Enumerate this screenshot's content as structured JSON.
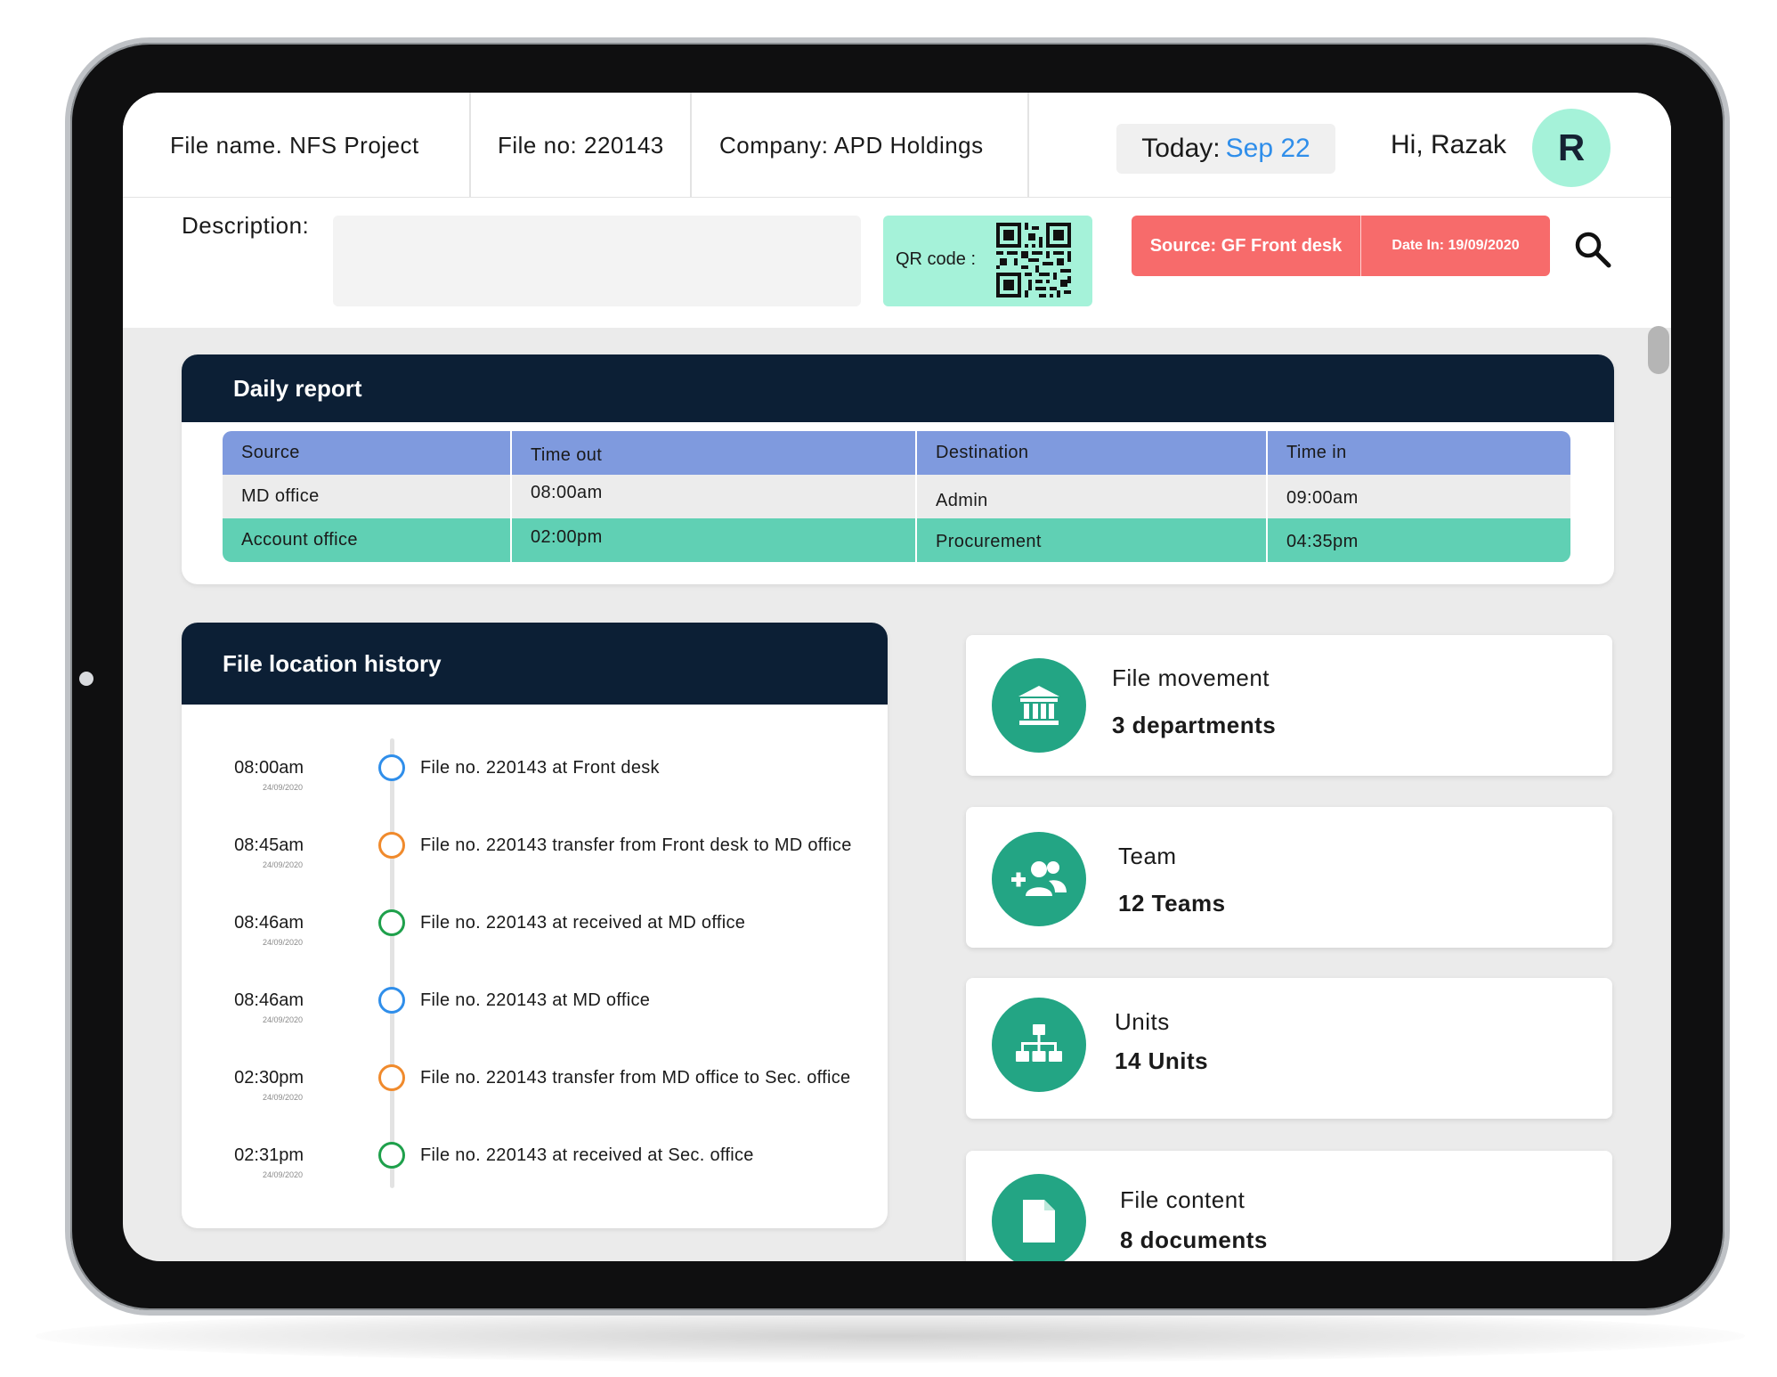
{
  "header": {
    "file_name": "File name. NFS Project",
    "file_no": "File no: 220143",
    "company": "Company: APD Holdings",
    "today_label": "Today:",
    "today_date": "Sep 22",
    "greeting": "Hi, Razak",
    "avatar_initial": "R"
  },
  "subheader": {
    "description_label": "Description:",
    "description_value": "",
    "qr_label": "QR code :",
    "source": "Source: GF Front desk",
    "date_in": "Date In: 19/09/2020"
  },
  "daily_report": {
    "title": "Daily report",
    "columns": [
      "Source",
      "Time out",
      "Destination",
      "Time in"
    ],
    "rows": [
      [
        "MD office",
        "08:00am",
        "Admin",
        "09:00am"
      ],
      [
        "Account office",
        "02:00pm",
        "Procurement",
        "04:35pm"
      ]
    ]
  },
  "history": {
    "title": "File location history",
    "items": [
      {
        "time": "08:00am",
        "date": "24/09/2020",
        "text": "File no. 220143 at Front desk"
      },
      {
        "time": "08:45am",
        "date": "24/09/2020",
        "text": "File no. 220143 transfer from Front desk to MD office"
      },
      {
        "time": "08:46am",
        "date": "24/09/2020",
        "text": "File no. 220143 at received at MD office"
      },
      {
        "time": "08:46am",
        "date": "24/09/2020",
        "text": "File no. 220143 at MD office"
      },
      {
        "time": "02:30pm",
        "date": "24/09/2020",
        "text": "File no. 220143 transfer from MD office to Sec. office"
      },
      {
        "time": "02:31pm",
        "date": "24/09/2020",
        "text": "File no. 220143 at received at Sec. office"
      }
    ]
  },
  "stats": [
    {
      "label": "File movement",
      "value": "3 departments",
      "icon": "bank-icon"
    },
    {
      "label": "Team",
      "value": "12 Teams",
      "icon": "add-team-icon"
    },
    {
      "label": "Units",
      "value": "14 Units",
      "icon": "org-chart-icon"
    },
    {
      "label": "File content",
      "value": "8 documents",
      "icon": "document-icon"
    }
  ],
  "colors": {
    "navy": "#0c1f35",
    "teal": "#23a584",
    "mint": "#a5f2d9",
    "coral": "#f76b6b",
    "table_head": "#7f9ade",
    "table_green": "#60d0b4",
    "dot_blue": "#2f8eea",
    "dot_orange": "#f08a2c",
    "dot_green": "#1ea04b"
  }
}
